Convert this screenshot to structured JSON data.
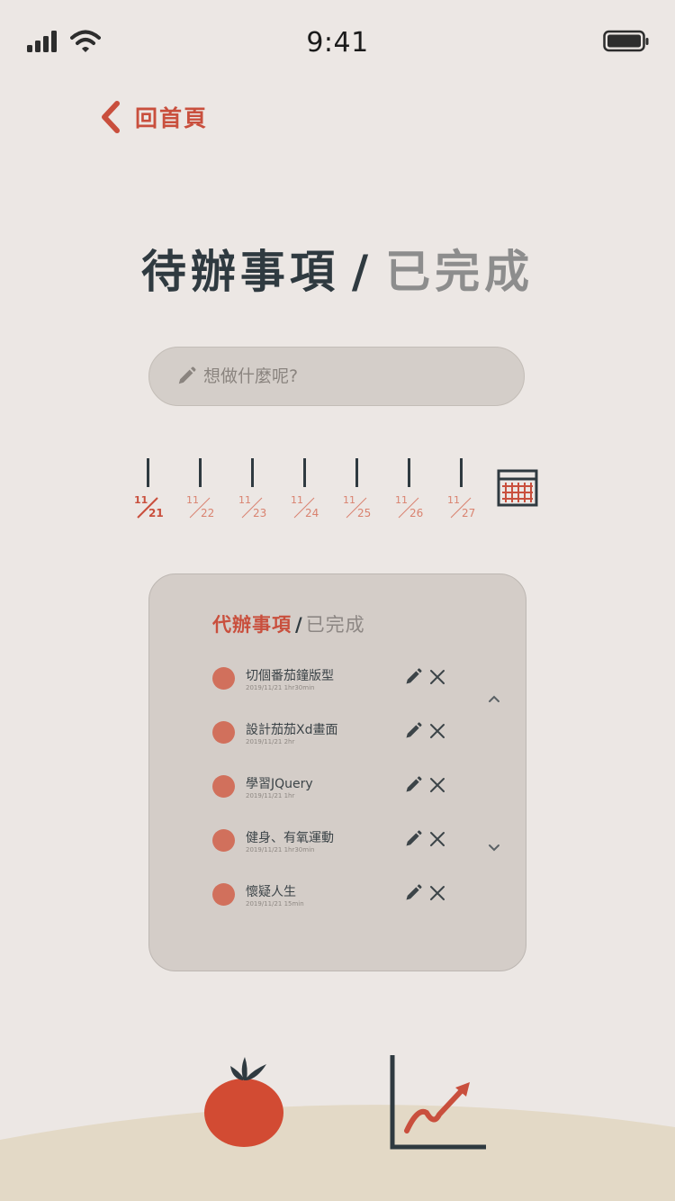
{
  "status_bar": {
    "time": "9:41"
  },
  "nav": {
    "back_label": "回首頁"
  },
  "header": {
    "title_active": "待辦事項",
    "separator": "/",
    "title_inactive": "已完成"
  },
  "search": {
    "placeholder": "想做什麼呢?"
  },
  "date_strip": {
    "dates": [
      {
        "month": "11",
        "day": "21",
        "active": true
      },
      {
        "month": "11",
        "day": "22",
        "active": false
      },
      {
        "month": "11",
        "day": "23",
        "active": false
      },
      {
        "month": "11",
        "day": "24",
        "active": false
      },
      {
        "month": "11",
        "day": "25",
        "active": false
      },
      {
        "month": "11",
        "day": "26",
        "active": false
      },
      {
        "month": "11",
        "day": "27",
        "active": false
      }
    ]
  },
  "card": {
    "tab_active": "代辦事項",
    "separator": "/",
    "tab_inactive": "已完成",
    "tasks": [
      {
        "name": "切個番茄鐘版型",
        "meta": "2019/11/21 1hr30min"
      },
      {
        "name": "設計茄茄Xd畫面",
        "meta": "2019/11/21 2hr"
      },
      {
        "name": "學習JQuery",
        "meta": "2019/11/21 1hr"
      },
      {
        "name": "健身、有氧運動",
        "meta": "2019/11/21 1hr30min"
      },
      {
        "name": "懷疑人生",
        "meta": "2019/11/21 15min"
      }
    ]
  },
  "colors": {
    "accent": "#c94f3d",
    "dot": "#d1705c",
    "dark": "#2f3a40",
    "background": "#ece7e4",
    "card": "#d4cdc8",
    "ground": "#e3d9c6"
  },
  "icons": {
    "back": "chevron-left-icon",
    "search": "pencil-icon",
    "calendar": "calendar-icon",
    "edit": "pencil-icon",
    "delete": "close-icon",
    "tomato": "tomato-icon",
    "stats": "chart-icon"
  }
}
